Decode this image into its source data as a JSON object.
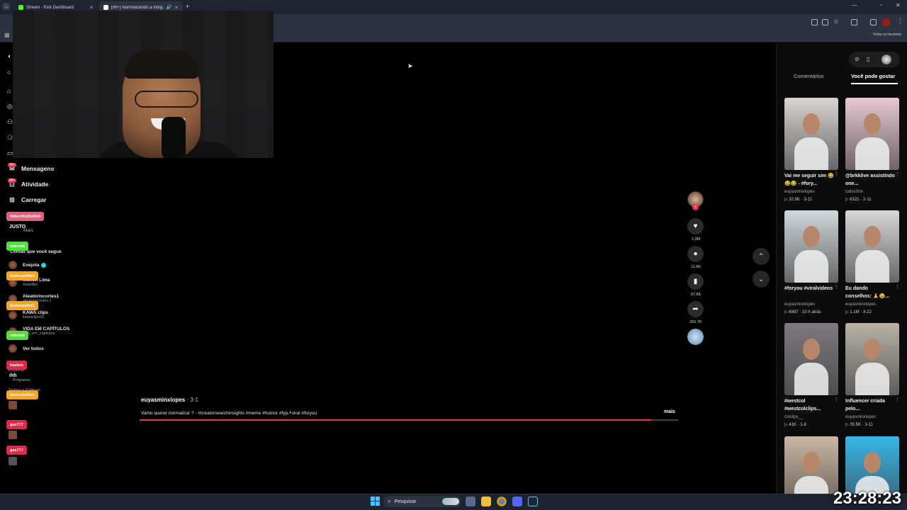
{
  "browser": {
    "tabs": [
      {
        "title": "Stream - Kick Dashboard",
        "favicon_color": "#53fc18"
      },
      {
        "title": "(99+) Normalizando a Indig...",
        "favicon_color": "#ffffff"
      }
    ],
    "bookmarks_label": "Todos os favoritos"
  },
  "sidebar": {
    "nav": [
      {
        "label": "Mensagens",
        "icon": "message-icon"
      },
      {
        "label": "Atividade",
        "icon": "activity-icon"
      },
      {
        "label": "Carregar",
        "icon": "upload-icon"
      }
    ],
    "badge": "99+",
    "more": "Mais",
    "following_title": "Contas que você segue",
    "accounts": [
      {
        "name": "Enejota",
        "handle": "",
        "verified": true
      },
      {
        "name": "Marlon Lima",
        "handle": "maarlfps"
      },
      {
        "name": "Aleatóriocortes1",
        "handle": "aleatoriocortes.1"
      },
      {
        "name": "KAWA clips",
        "handle": "kawaclips01"
      },
      {
        "name": "VIDA EM CAPÍTULOS",
        "handle": "vida_em_capitulos"
      }
    ],
    "see_all": "Ver todos",
    "footer": [
      "Empresa",
      "Programa",
      "Termos e Políticas"
    ]
  },
  "chat_overlay": [
    {
      "text": "Heber0t1d0zIkk0",
      "color": "#e0607a"
    },
    {
      "text": "JUSTO",
      "color": "transparent"
    },
    {
      "text": "cabstatt",
      "color": "#4ddf3a"
    },
    {
      "text": "kevinsosfire1",
      "color": "#f5a623"
    },
    {
      "text": "kevinsosfire1",
      "color": "#f5a623"
    },
    {
      "text": "cabstatt",
      "color": "#4ddf3a"
    },
    {
      "text": "hashxx",
      "color": "#e8254a"
    },
    {
      "text": "ihh",
      "color": "transparent"
    },
    {
      "text": "kevinsosfire1",
      "color": "#f5a623"
    },
    {
      "text": "gax777",
      "color": "#e8254a"
    },
    {
      "text": "gax777",
      "color": "#e8254a"
    }
  ],
  "video": {
    "username": "euyasminxlopes",
    "date": "3-1",
    "caption": "Vamo querer normalizar ? - #creatorsearchinsights #meme #humor #fyp↗viral #foryou",
    "more_label": "mais",
    "progress": 0.95,
    "actions": {
      "likes": "1.3M",
      "comments": "11.6K",
      "saves": "97.6K",
      "shares": "261.7K"
    }
  },
  "right_panel": {
    "tabs": [
      "Comentários",
      "Você pode gostar"
    ],
    "active_tab": 1,
    "videos": [
      {
        "title": "Vai me seguir sim 😂😂😂 - #fory...",
        "user": "euyasminxlopes",
        "views": "32.8K",
        "age": "3-11",
        "bg": "#d9d4cf"
      },
      {
        "title": "@brkklive assistindo one...",
        "user": "tudoc0rte",
        "views": "6321",
        "age": "2-11",
        "bg": "#e8c9d6"
      },
      {
        "title": "#foryou #viralvideos",
        "user": "euyasminxlopes",
        "views": "6897",
        "age": "10 h atrás",
        "bg": "#cfd8dc"
      },
      {
        "title": "Eu dando conselhos: 🙏😂...",
        "user": "euyasminxlopes",
        "views": "1.1M",
        "age": "3-22",
        "bg": "#d7d7d7"
      },
      {
        "title": "#westcol #westcolclips...",
        "user": "colclips__",
        "views": "41K",
        "age": "1-8",
        "bg": "#7e7a80"
      },
      {
        "title": "Influencer criada pelo...",
        "user": "euyasminxlopes",
        "views": "35.5K",
        "age": "3-11",
        "bg": "#b8b2a8"
      },
      {
        "title": "",
        "user": "",
        "views": "",
        "age": "",
        "bg": "#cbb6a2"
      },
      {
        "title": "",
        "user": "",
        "views": "",
        "age": "",
        "bg": "#38b7e8"
      }
    ]
  },
  "taskbar": {
    "search_placeholder": "Pesquisar",
    "clock": "23:28:23"
  },
  "colors": {
    "accent": "#fe2c55",
    "background": "#000000"
  }
}
